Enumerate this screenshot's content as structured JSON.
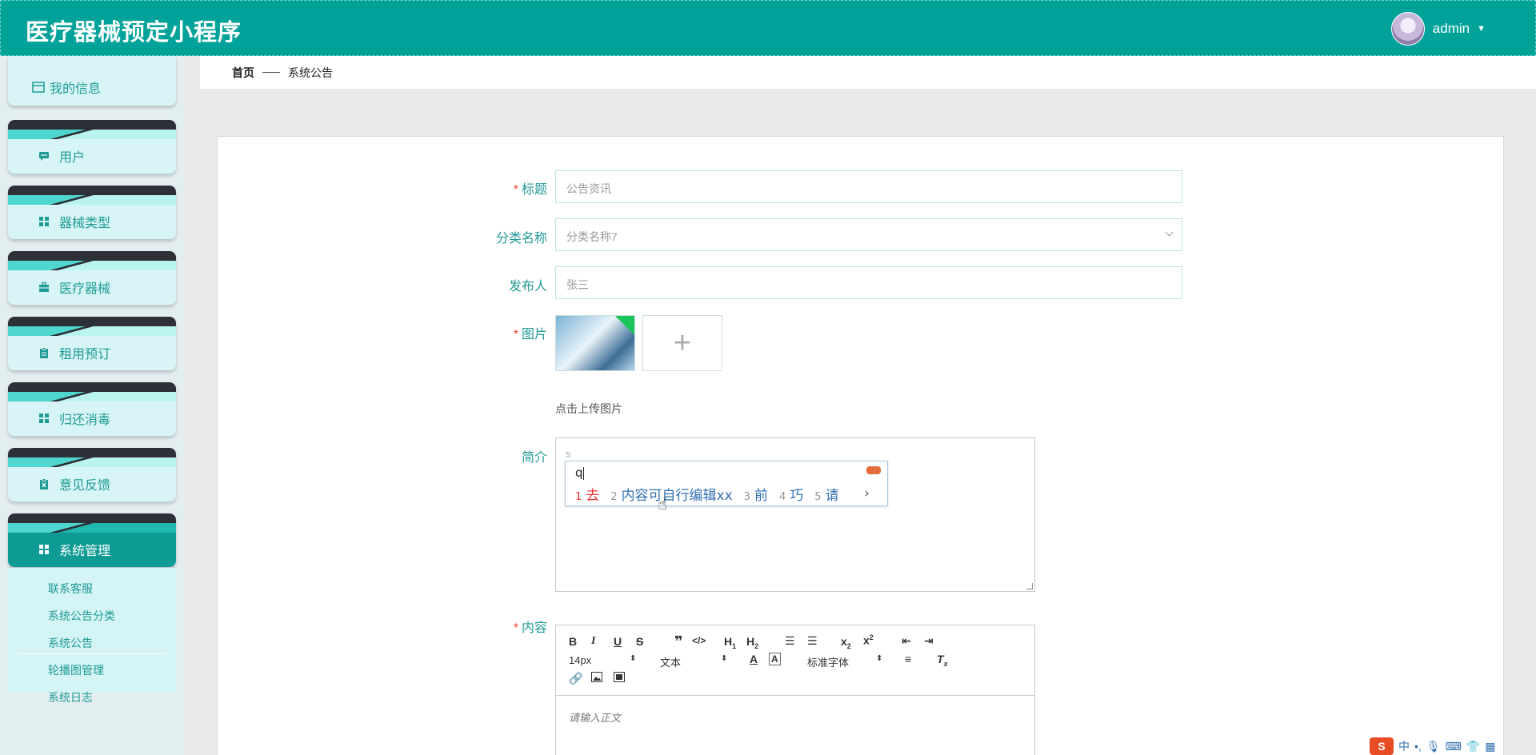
{
  "header": {
    "title": "医疗器械预定小程序",
    "username": "admin"
  },
  "sidebar": {
    "first_item": "我的信息",
    "items": [
      {
        "label": "用户",
        "icon": "chat-icon"
      },
      {
        "label": "器械类型",
        "icon": "grid-icon"
      },
      {
        "label": "医疗器械",
        "icon": "briefcase-icon"
      },
      {
        "label": "租用预订",
        "icon": "clipboard-icon"
      },
      {
        "label": "归还消毒",
        "icon": "grid-icon"
      },
      {
        "label": "意见反馈",
        "icon": "clipboard-x-icon"
      },
      {
        "label": "系统管理",
        "icon": "grid-icon",
        "active": true
      }
    ],
    "submenu": [
      "联系客服",
      "系统公告分类",
      "系统公告",
      "轮播图管理",
      "系统日志"
    ]
  },
  "breadcrumb": {
    "home": "首页",
    "current": "系统公告"
  },
  "form": {
    "title_label": "标题",
    "title_value": "公告资讯",
    "category_label": "分类名称",
    "category_value": "分类名称7",
    "publisher_label": "发布人",
    "publisher_value": "张三",
    "image_label": "图片",
    "upload_plus": "+",
    "upload_tip": "点击上传图片",
    "intro_label": "简介",
    "intro_value": "s",
    "content_label": "内容",
    "content_placeholder": "请输入正文"
  },
  "ime": {
    "typed": "q",
    "candidates": [
      {
        "num": "1",
        "text": "去"
      },
      {
        "num": "2",
        "text": "内容可自行编辑xx"
      },
      {
        "num": "3",
        "text": "前"
      },
      {
        "num": "4",
        "text": "巧"
      },
      {
        "num": "5",
        "text": "请"
      }
    ],
    "next": "›"
  },
  "editor_toolbar": {
    "font_size": "14px",
    "block": "文本",
    "font_family": "标准字体"
  },
  "imebar": {
    "logo": "S",
    "lang": "中"
  },
  "colors": {
    "primary": "#00a29a",
    "menu_text": "#1f9a95",
    "menu_bg": "#d7f5f6"
  }
}
